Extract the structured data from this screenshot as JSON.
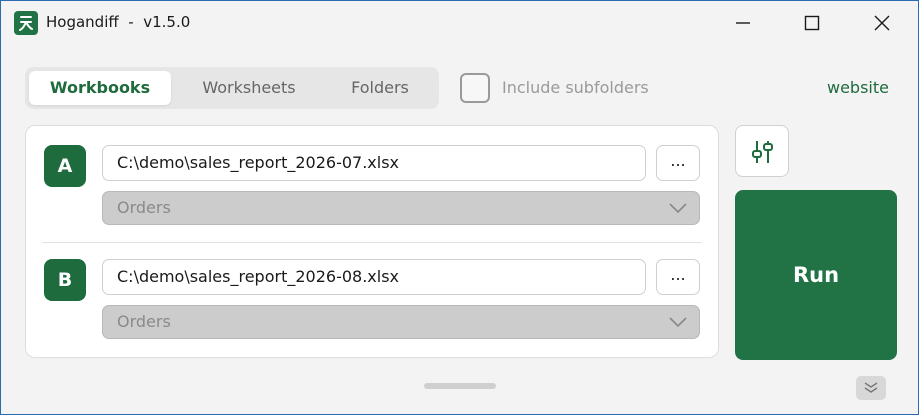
{
  "window": {
    "app_name": "Hogandiff",
    "title_separator": "-",
    "version": "v1.5.0",
    "icon_glyph": "ꟸ"
  },
  "tabs": [
    {
      "label": "Workbooks",
      "active": true
    },
    {
      "label": "Worksheets",
      "active": false
    },
    {
      "label": "Folders",
      "active": false
    }
  ],
  "options": {
    "include_subfolders_label": "Include subfolders",
    "include_subfolders_checked": false,
    "website_label": "website"
  },
  "book_a": {
    "badge": "A",
    "path": "C:\\demo\\sales_report_2026-07.xlsx",
    "browse_label": "...",
    "sheet": "Orders"
  },
  "book_b": {
    "badge": "B",
    "path": "C:\\demo\\sales_report_2026-08.xlsx",
    "browse_label": "...",
    "sheet": "Orders"
  },
  "run_label": "Run",
  "colors": {
    "accent": "#217346",
    "accent_dark": "#1e6b3e",
    "window_bg": "#f3f3f3",
    "disabled_select": "#cccccc"
  }
}
